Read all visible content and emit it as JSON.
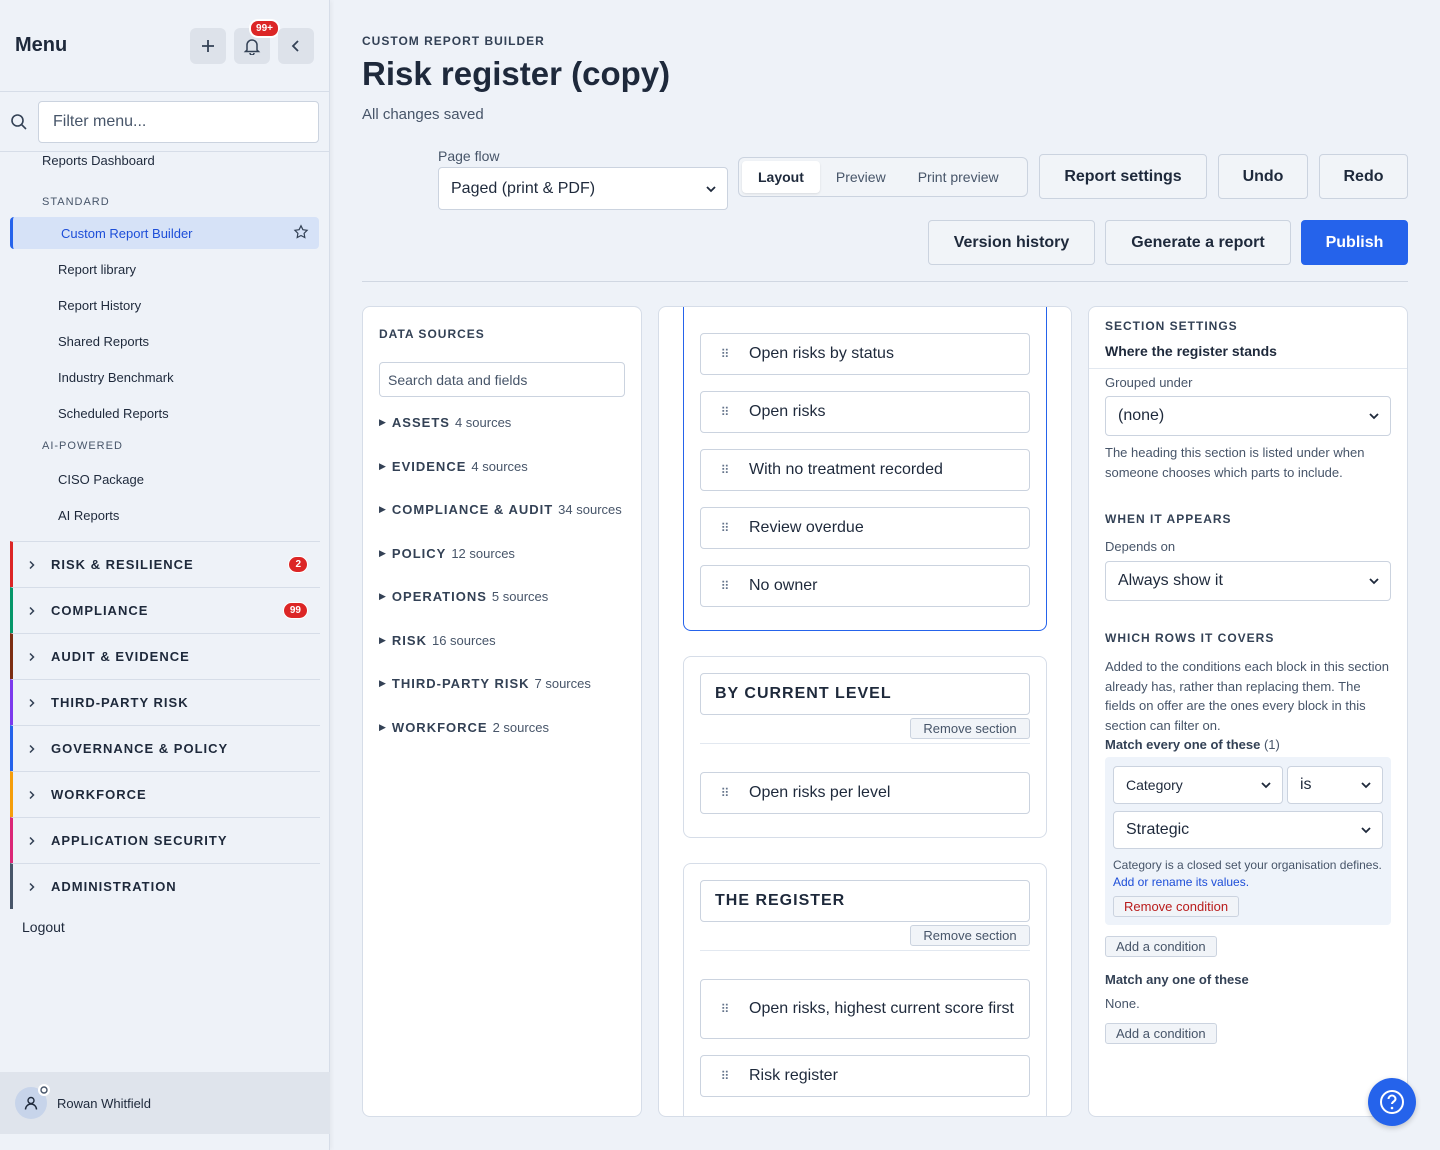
{
  "sidebar": {
    "title": "Menu",
    "notif_count": "99+",
    "filter_placeholder": "Filter menu...",
    "top_link": "Reports Dashboard",
    "groups": [
      {
        "label": "STANDARD"
      },
      {
        "label": "AI-POWERED"
      }
    ],
    "active_item": "Custom Report Builder",
    "standard_items": [
      "Report library",
      "Report History",
      "Shared Reports",
      "Industry Benchmark",
      "Scheduled Reports"
    ],
    "ai_items": [
      "CISO Package",
      "AI Reports"
    ],
    "sections": [
      {
        "label": "RISK & RESILIENCE",
        "count": "2",
        "color": "#dc2626"
      },
      {
        "label": "COMPLIANCE",
        "count": "99",
        "color": "#059669"
      },
      {
        "label": "AUDIT & EVIDENCE",
        "count": "",
        "color": "#7c2d12"
      },
      {
        "label": "THIRD-PARTY RISK",
        "count": "",
        "color": "#7c3aed"
      },
      {
        "label": "GOVERNANCE & POLICY",
        "count": "",
        "color": "#2563eb"
      },
      {
        "label": "WORKFORCE",
        "count": "",
        "color": "#f59e0b"
      },
      {
        "label": "APPLICATION SECURITY",
        "count": "",
        "color": "#db2777"
      },
      {
        "label": "ADMINISTRATION",
        "count": "",
        "color": "#475569"
      }
    ],
    "logout": "Logout",
    "user_name": "Rowan Whitfield"
  },
  "header": {
    "eyebrow": "CUSTOM REPORT BUILDER",
    "title": "Risk register (copy)",
    "status": "All changes saved",
    "page_flow_label": "Page flow",
    "page_flow_value": "Paged (print & PDF)",
    "view_tabs": [
      "Layout",
      "Preview",
      "Print preview"
    ],
    "active_tab": "Layout",
    "buttons": {
      "report_settings": "Report settings",
      "undo": "Undo",
      "redo": "Redo",
      "version_history": "Version history",
      "generate": "Generate a report",
      "publish": "Publish"
    }
  },
  "data_sources": {
    "title": "DATA SOURCES",
    "search_placeholder": "Search data and fields",
    "items": [
      {
        "name": "ASSETS",
        "count": "4 sources"
      },
      {
        "name": "EVIDENCE",
        "count": "4 sources"
      },
      {
        "name": "COMPLIANCE & AUDIT",
        "count": "34 sources"
      },
      {
        "name": "POLICY",
        "count": "12 sources"
      },
      {
        "name": "OPERATIONS",
        "count": "5 sources"
      },
      {
        "name": "RISK",
        "count": "16 sources"
      },
      {
        "name": "THIRD-PARTY RISK",
        "count": "7 sources"
      },
      {
        "name": "WORKFORCE",
        "count": "2 sources"
      }
    ]
  },
  "canvas": {
    "first_section_blocks": [
      "Open risks by status",
      "Open risks",
      "With no treatment recorded",
      "Review overdue",
      "No owner"
    ],
    "sections": [
      {
        "title": "BY CURRENT LEVEL",
        "remove": "Remove section",
        "blocks": [
          "Open risks per level"
        ]
      },
      {
        "title": "THE REGISTER",
        "remove": "Remove section",
        "blocks": [
          "Open risks, highest current score first",
          "Risk register"
        ]
      }
    ]
  },
  "section_settings": {
    "title": "SECTION SETTINGS",
    "subtitle": "Where the register stands",
    "grouped_under_label": "Grouped under",
    "grouped_under_value": "(none)",
    "grouped_help": "The heading this section is listed under when someone chooses which parts to include.",
    "when_heading": "WHEN IT APPEARS",
    "depends_label": "Depends on",
    "depends_value": "Always show it",
    "rows_heading": "WHICH ROWS IT COVERS",
    "rows_help": "Added to the conditions each block in this section already has, rather than replacing them. The fields on offer are the ones every block in this section can filter on.",
    "match_every": "Match every one of these",
    "match_every_count": "(1)",
    "cond_field": "Category",
    "cond_op": "is",
    "cond_value": "Strategic",
    "cond_note": "Category is a closed set your organisation defines.",
    "cond_link": "Add or rename its values.",
    "remove_condition": "Remove condition",
    "add_condition": "Add a condition",
    "match_any": "Match any one of these",
    "none": "None.",
    "add_condition_2": "Add a condition"
  }
}
